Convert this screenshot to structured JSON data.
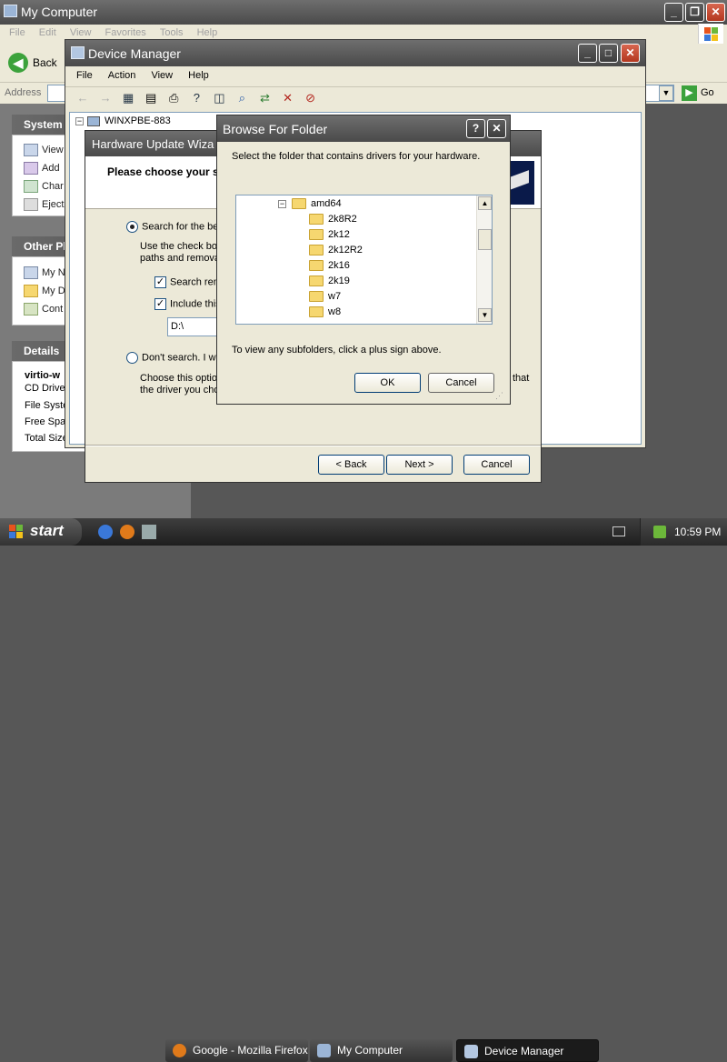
{
  "mycomputer": {
    "title": "My Computer",
    "menu": [
      "File",
      "Edit",
      "View",
      "Favorites",
      "Tools",
      "Help"
    ],
    "back_label": "Back",
    "address_label": "Address",
    "go_label": "Go",
    "system_tasks": {
      "title": "System",
      "items": [
        "View",
        "Add",
        "Char",
        "Eject"
      ]
    },
    "other_places": {
      "title": "Other Pl",
      "items": [
        "My N",
        "My D",
        "Cont"
      ]
    },
    "details": {
      "title": "Details",
      "name": "virtio-w",
      "items": [
        "CD Drive",
        "File Syste",
        "Free Spac",
        "Total Size"
      ]
    }
  },
  "device_manager": {
    "title": "Device Manager",
    "menu": [
      "File",
      "Action",
      "View",
      "Help"
    ],
    "tree_root": "WINXPBE-883"
  },
  "wizard": {
    "title": "Hardware Update Wiza",
    "heading": "Please choose your s",
    "radio_search": "Search for the be",
    "search_desc": "Use the check bo",
    "search_desc2": "paths and remova",
    "check_removable": "Search rem",
    "check_include": "Include this",
    "path_value": "D:\\",
    "radio_dont": "Don't search. I wi",
    "dont_desc": "Choose this optio",
    "dont_desc2": "the driver you cho",
    "dont_desc_tail": "that",
    "back_button": "< Back",
    "next_button": "Next >",
    "cancel_button": "Cancel"
  },
  "browse": {
    "title": "Browse For Folder",
    "instruction": "Select the folder that contains drivers for your hardware.",
    "tree": [
      {
        "label": "amd64",
        "expanded": true
      },
      {
        "label": "2k8R2"
      },
      {
        "label": "2k12"
      },
      {
        "label": "2k12R2"
      },
      {
        "label": "2k16"
      },
      {
        "label": "2k19"
      },
      {
        "label": "w7"
      },
      {
        "label": "w8"
      }
    ],
    "hint": "To view any subfolders, click a plus sign above.",
    "ok_button": "OK",
    "cancel_button": "Cancel"
  },
  "taskbar": {
    "start": "start",
    "tasks": [
      "Google - Mozilla Firefox",
      "My Computer",
      "Device Manager"
    ],
    "clock": "10:59 PM"
  }
}
